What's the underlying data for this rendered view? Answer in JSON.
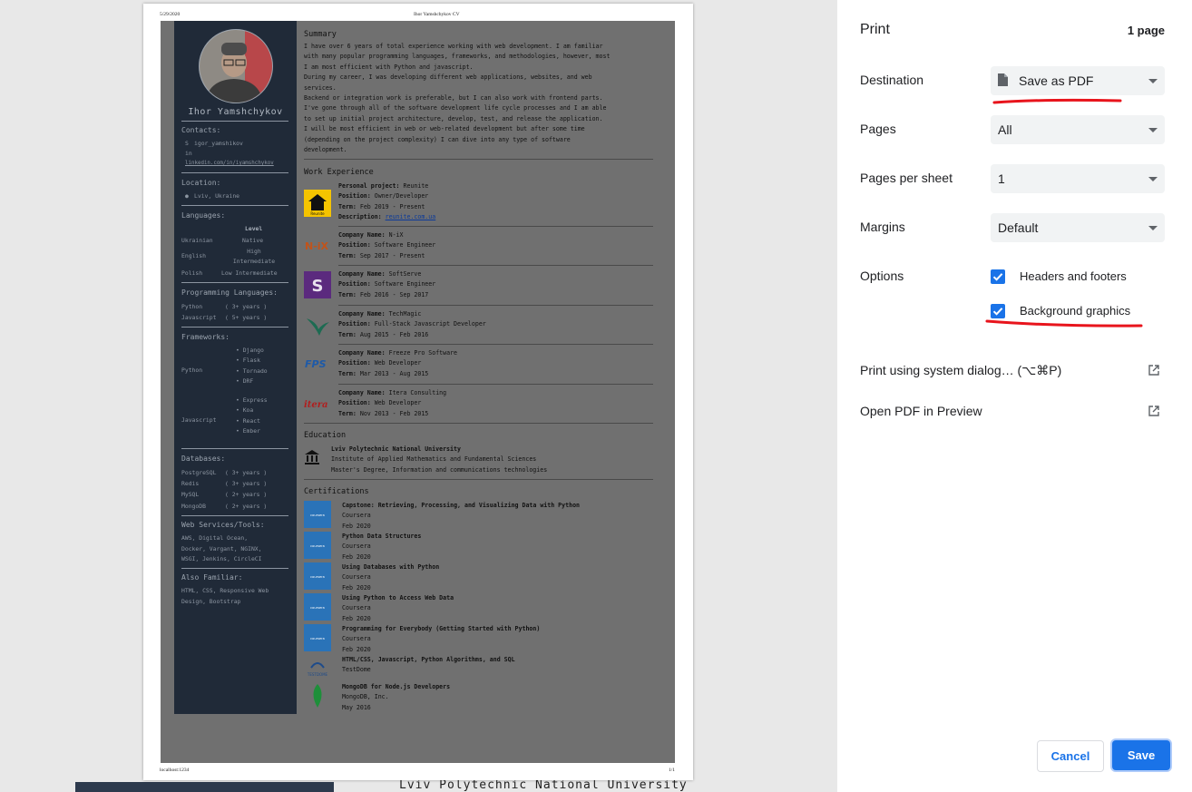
{
  "preview": {
    "header_date": "5/29/2020",
    "header_title": "Ihor Yamshchykov CV",
    "footer_url": "localhost:1234",
    "footer_page": "1/1",
    "under_text": "Lviv Polytechnic National University"
  },
  "cv": {
    "name": "Ihor Yamshchykov",
    "contacts_title": "Contacts:",
    "skype": "igor_yamshikov",
    "linkedin": "linkedin.com/in/iyamshchykov",
    "location_title": "Location:",
    "location": "Lviv, Ukraine",
    "languages_title": "Languages:",
    "languages_level_header": "Level",
    "languages": [
      {
        "name": "Ukrainian",
        "level": "Native"
      },
      {
        "name": "English",
        "level": "High Intermediate"
      },
      {
        "name": "Polish",
        "level": "Low Intermediate"
      }
    ],
    "prog_title": "Programming Languages:",
    "prog": [
      {
        "name": "Python",
        "years": "( 3+ years )"
      },
      {
        "name": "Javascript",
        "years": "( 5+ years )"
      }
    ],
    "frameworks_title": "Frameworks:",
    "frameworks": {
      "python_label": "Python",
      "python": [
        "Django",
        "Flask",
        "Tornado",
        "DRF"
      ],
      "js_label": "Javascript",
      "js": [
        "Express",
        "Koa",
        "React",
        "Ember"
      ]
    },
    "databases_title": "Databases:",
    "databases": [
      {
        "name": "PostgreSQL",
        "years": "( 3+ years )"
      },
      {
        "name": "Redis",
        "years": "( 3+ years )"
      },
      {
        "name": "MySQL",
        "years": "( 2+ years )"
      },
      {
        "name": "MongoDB",
        "years": "( 2+ years )"
      }
    ],
    "webservices_title": "Web Services/Tools:",
    "webservices_lines": [
      "AWS, Digital Ocean,",
      "Docker, Vargant, NGINX,",
      "WSGI, Jenkins, CircleCI"
    ],
    "also_title": "Also Familiar:",
    "also_lines": [
      "HTML, CSS, Responsive Web",
      "Design, Bootstrap"
    ],
    "summary_title": "Summary",
    "summary_lines": [
      "  I have over 6 years of total experience working with web development. I am familiar",
      "with many popular programming languages, frameworks, and methodologies, however, most",
      "I am most efficient with Python and javascript.",
      "  During my career, I was developing different web applications, websites, and web",
      "services.",
      "  Backend or integration work is preferable, but I can also work with frontend parts.",
      "I've gone through all of the software development life cycle processes and I am able",
      "to set up initial project architecture, develop, test, and release the application.",
      "  I will be most efficient in web or web-related development but after some time",
      "(depending on the project complexity) I can dive into any type of software",
      "development."
    ],
    "work_title": "Work Experience",
    "personal": {
      "label1": "Personal project:",
      "value1": "Reunite",
      "label2": "Position:",
      "value2": "Owner/Developer",
      "label3": "Term:",
      "value3": "Feb 2019 - Present",
      "label4": "Description:",
      "value4": "reunite.com.ua",
      "logo_text": "Reunite"
    },
    "jobs": [
      {
        "company": "N-iX",
        "position": "Software Engineer",
        "term": "Sep 2017 - Present",
        "logo": "N-iX"
      },
      {
        "company": "SoftServe",
        "position": "Software Engineer",
        "term": "Feb 2016 - Sep 2017",
        "logo": "S"
      },
      {
        "company": "TechMagic",
        "position": "Full-Stack Javascript Developer",
        "term": "Aug 2015 - Feb 2016",
        "logo": "bird"
      },
      {
        "company": "Freeze Pro Software",
        "position": "Web Developer",
        "term": "Mar 2013 - Aug 2015",
        "logo": "FPS"
      },
      {
        "company": "Itera Consulting",
        "position": "Web Developer",
        "term": "Nov 2013 - Feb 2015",
        "logo": "itera"
      }
    ],
    "job_labels": {
      "company": "Company Name:",
      "position": "Position:",
      "term": "Term:"
    },
    "education_title": "Education",
    "education": {
      "school": "Lviv Polytechnic National University",
      "institute": "Institute of Applied Mathematics and Fundamental Sciences",
      "degree": "Master's Degree, Information and communications technologies"
    },
    "certs_title": "Certifications",
    "certs": [
      {
        "title": "Capstone: Retrieving, Processing, and Visualizing Data with Python",
        "issuer": "Coursera",
        "date": "Feb 2020",
        "logo": "coursera"
      },
      {
        "title": "Python Data Structures",
        "issuer": "Coursera",
        "date": "Feb 2020",
        "logo": "coursera"
      },
      {
        "title": "Using Databases with Python",
        "issuer": "Coursera",
        "date": "Feb 2020",
        "logo": "coursera"
      },
      {
        "title": "Using Python to Access Web Data",
        "issuer": "Coursera",
        "date": "Feb 2020",
        "logo": "coursera"
      },
      {
        "title": "Programming for Everybody (Getting Started with Python)",
        "issuer": "Coursera",
        "date": "Feb 2020",
        "logo": "coursera"
      },
      {
        "title": "HTML/CSS, Javascript, Python Algorithms, and SQL",
        "issuer": "TestDome",
        "date": "",
        "logo": "TESTDOME"
      },
      {
        "title": "MongoDB for Node.js Developers",
        "issuer": "MongoDB, Inc.",
        "date": "May 2016",
        "logo": "leaf"
      }
    ]
  },
  "print": {
    "title": "Print",
    "page_count": "1 page",
    "destination_label": "Destination",
    "destination_value": "Save as PDF",
    "pages_label": "Pages",
    "pages_value": "All",
    "pps_label": "Pages per sheet",
    "pps_value": "1",
    "margins_label": "Margins",
    "margins_value": "Default",
    "options_label": "Options",
    "opt_headers": "Headers and footers",
    "opt_headers_checked": true,
    "opt_bg": "Background graphics",
    "opt_bg_checked": true,
    "system_dialog": "Print using system dialog… (⌥⌘P)",
    "open_preview": "Open PDF in Preview",
    "cancel": "Cancel",
    "save": "Save",
    "accent_color": "#1a73e8",
    "annotation_color": "#e8141c"
  }
}
